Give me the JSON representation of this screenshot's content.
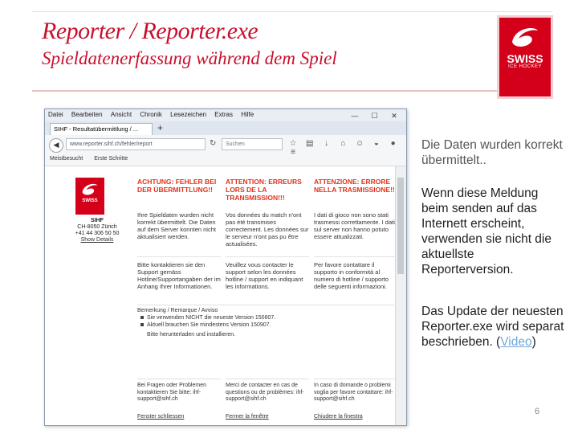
{
  "slide": {
    "title": "Reporter / Reporter.exe",
    "subtitle": "Spieldatenerfassung während dem Spiel",
    "page_number": "6"
  },
  "logo": {
    "line1": "SWISS",
    "line2": "ICE HOCKEY"
  },
  "browser": {
    "menu": [
      "Datei",
      "Bearbeiten",
      "Ansicht",
      "Chronik",
      "Lesezeichen",
      "Extras",
      "Hilfe"
    ],
    "window_controls": [
      "—",
      "☐",
      "✕"
    ],
    "tab_label": "SIHF - Resultatübermittlung / ...",
    "new_tab": "+",
    "url": "www.reporter.sihf.ch/fehler/report",
    "search_placeholder": "Suchen",
    "bookmarks": [
      "Meistbesucht",
      "Erste Schritte"
    ]
  },
  "webpage": {
    "logo_text": "SWISS",
    "sihf_name": "SIHF",
    "sihf_addr": "CH-8050 Zürich",
    "sihf_phone": "+41 44 306 50 50",
    "sihf_link": "Show Details",
    "columns": [
      {
        "heading": "ACHTUNG: FEHLER BEI DER ÜBERMITTLUNG!!",
        "body": "Ihre Spieldaten wurden nicht korrekt übermittelt. Die Daten auf dem Server konnten nicht aktualisiert werden.",
        "note": "Bitte kontaktieren sie den Support gemäss Hotline/Supportangaben der im Anhang Ihrer Informationen."
      },
      {
        "heading": "ATTENTION: ERREURS LORS DE LA TRANSMISSION!!!",
        "body": "Vos données du match n'ont pas été transmises correctement. Les données sur le serveur n'ont pas pu être actualisées.",
        "note": "Veuillez vous contacter le support selon les données hotline / support en indiquant les informations."
      },
      {
        "heading": "ATTENZIONE: ERRORE NELLA TRASMISSIONE!!!",
        "body": "I dati di gioco non sono stati trasmessi correttamente. I dati sul server non hanno potuto essere attualizzati.",
        "note": "Per favore contattare il supporto in conformità al numero di hotline / supporto delle seguenti informazioni."
      }
    ],
    "notice": {
      "heading": "Bemerkung / Remarque / Avviso",
      "bullets": [
        "Sie verwenden NICHT die neueste Version 150607.",
        "Aktuell brauchen Sie mindestens Version 150907."
      ],
      "instruction": "Bitte herunterladen und installieren."
    },
    "contacts": [
      "Bei Fragen oder Problemen kontaktieren Sie bitte: ihf-support@sihf.ch",
      "Merci de contacter en cas de questions ou de problèmes: ihf-support@sihf.ch",
      "In caso di domande o problemi voglia per favore contattare: ihf-support@sihf.ch"
    ],
    "footer_links": [
      "Fenster schliessen",
      "Fermer la fenêtre",
      "Chiudere la finestra"
    ]
  },
  "explanation": {
    "line1": "Die Daten wurden korrekt übermittelt..",
    "line2": "Wenn diese Meldung beim senden auf das Internett erscheint, verwenden sie nicht die aktuellste Reporterversion.",
    "line3_prefix": "Das Update der neuesten Reporter.exe wird separat beschrieben. (",
    "video_link": "Video",
    "line3_suffix": ")"
  },
  "colors": {
    "accent": "#c8102e",
    "logo_red": "#d4001a",
    "link": "#6fa8dc",
    "error": "#e0321c"
  }
}
